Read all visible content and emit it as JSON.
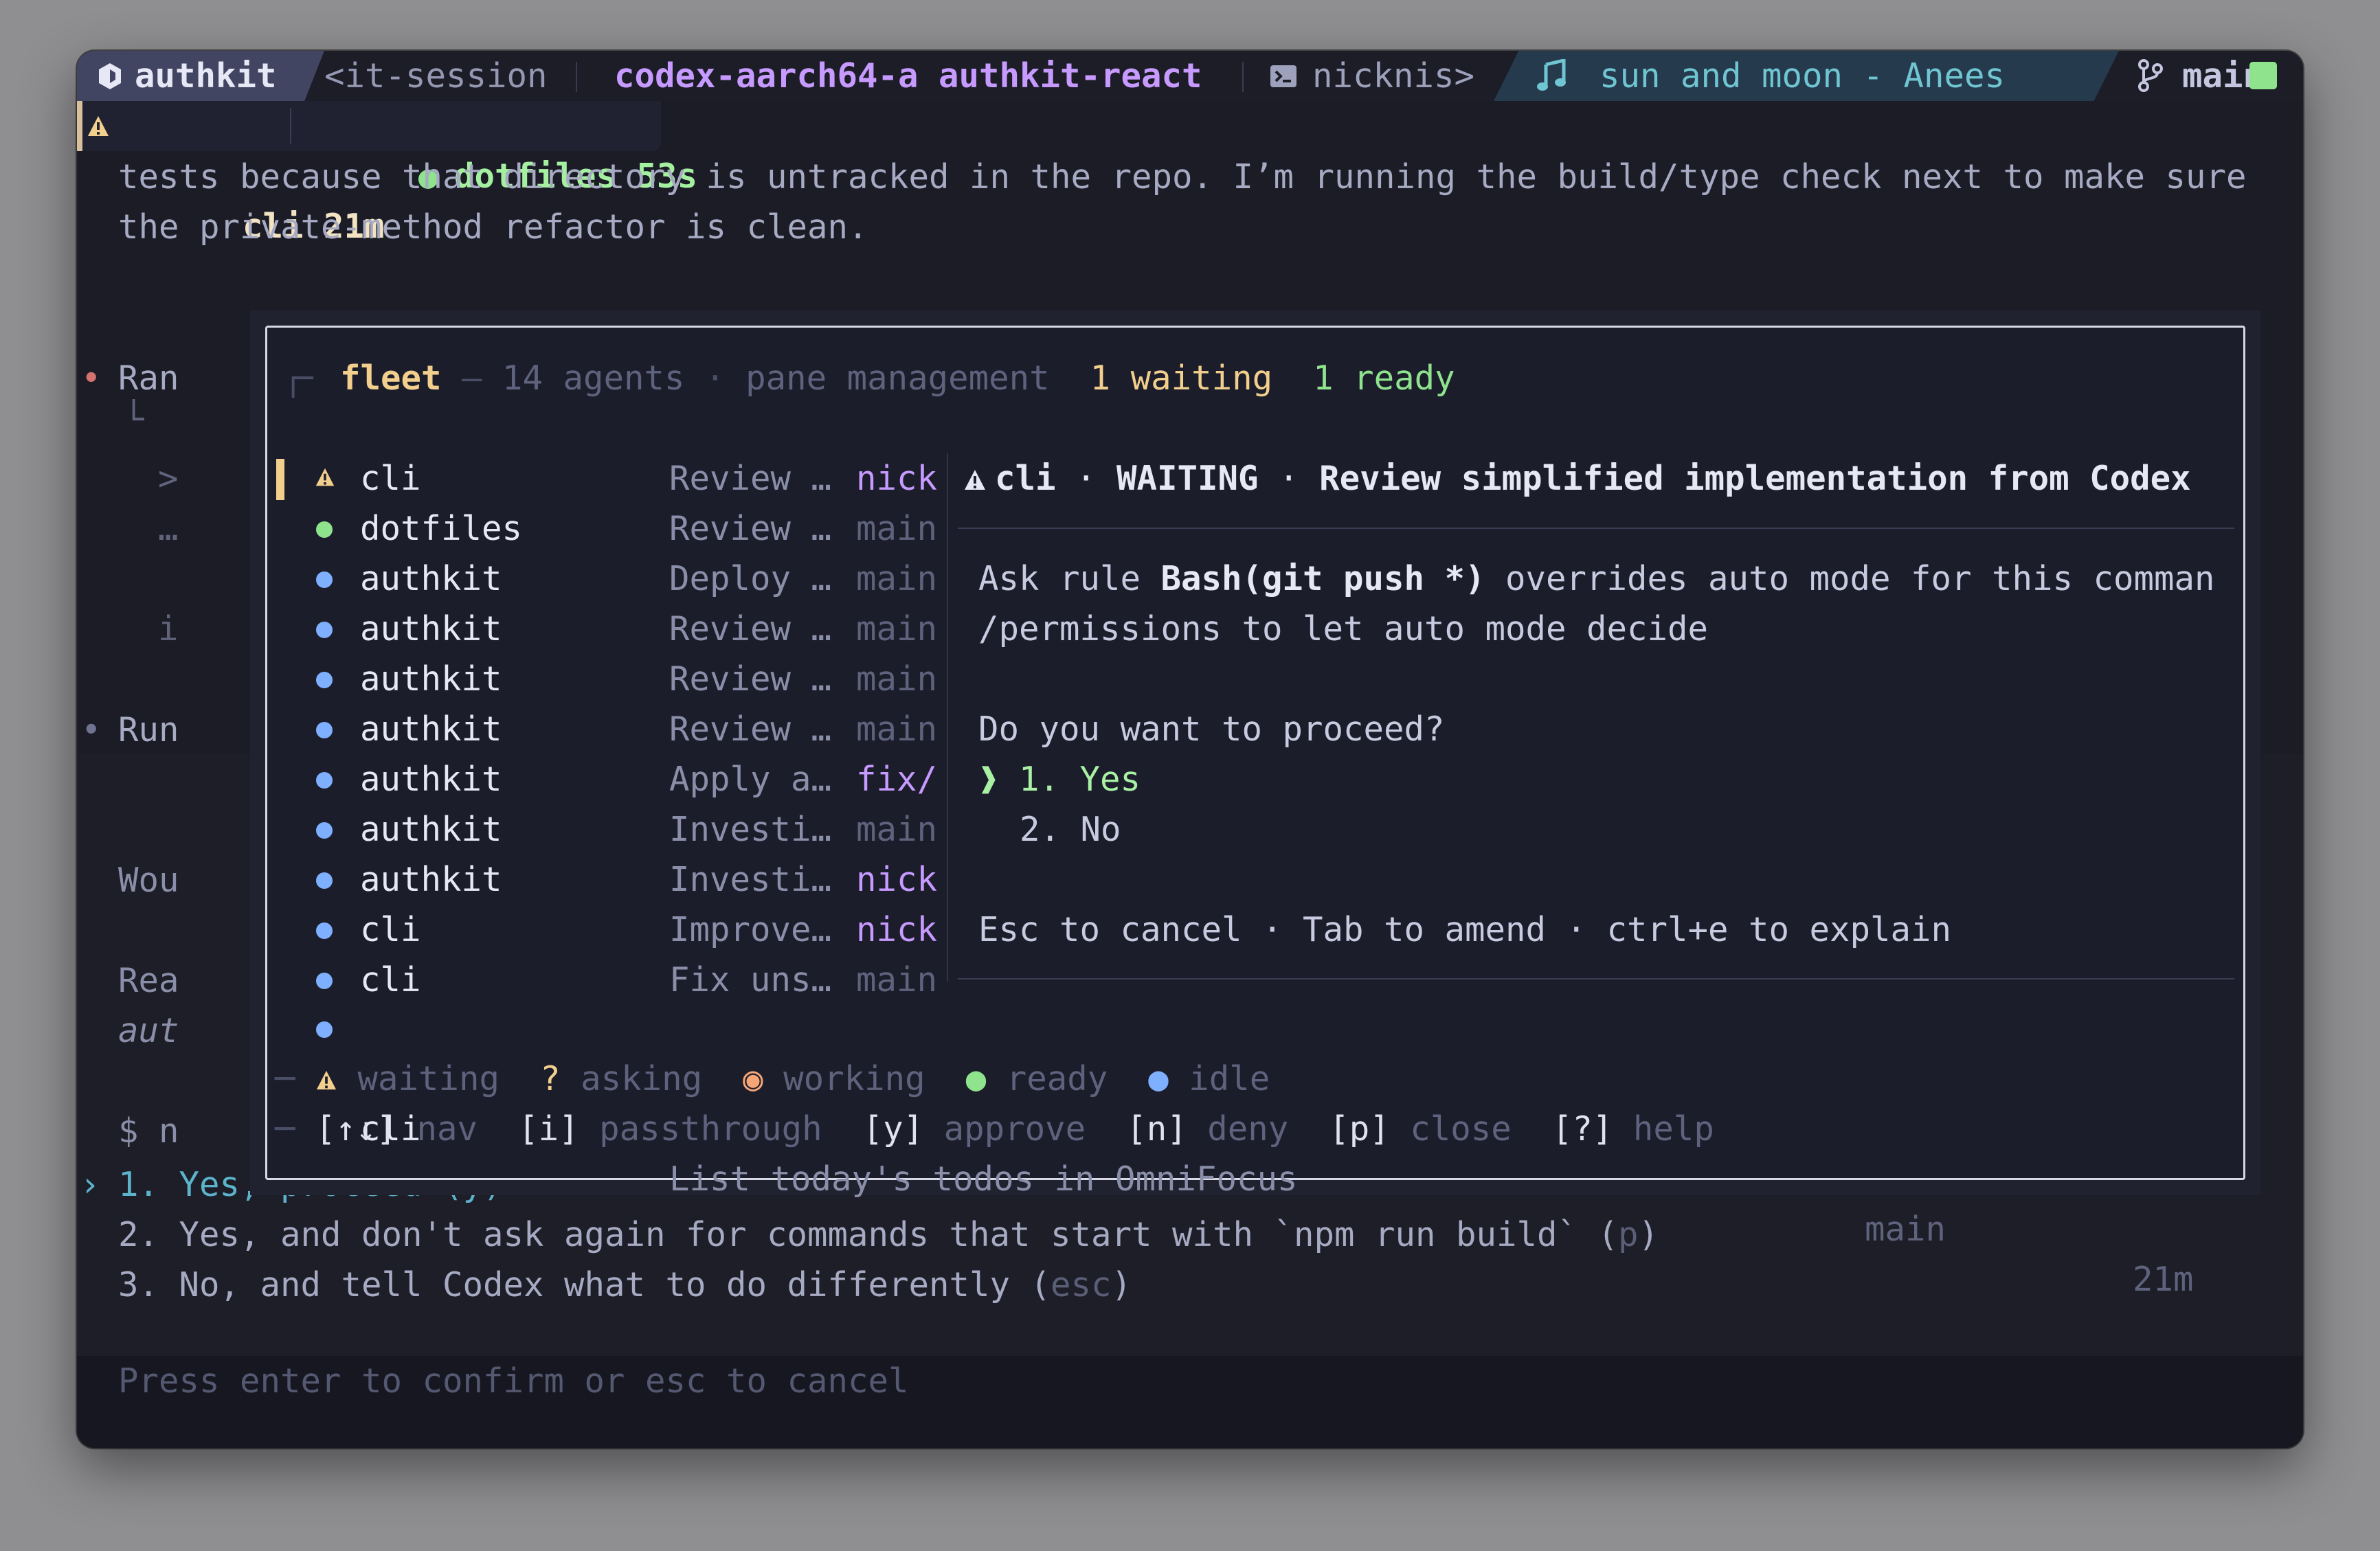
{
  "statusbar": {
    "session": "authkit",
    "session_suffix": "<it-session",
    "host": "codex-aarch64-a authkit-react",
    "shell": "nicknis>",
    "music": "sun and moon - Anees",
    "branch": "main"
  },
  "tabs": [
    {
      "label": "cli 21m"
    },
    {
      "label": "dotfiles 53s"
    }
  ],
  "background": {
    "line1": "tests because that directory is untracked in the repo. I’m running the build/type check next to make sure",
    "line2": "the private-method refactor is clean.",
    "ran": "Ran",
    "run": "Run",
    "wou": "Wou",
    "rea": "Rea",
    "aut": "aut",
    "prompt": "$ n",
    "gt": ">",
    "ellipsis": "…",
    "i": "i",
    "elbow": "└"
  },
  "fleet": {
    "title": "fleet",
    "agents": "14 agents",
    "subtitle": "pane management",
    "waiting": "1 waiting",
    "ready": "1 ready",
    "rows": [
      {
        "name": "cli",
        "desc": "Review …",
        "branch": "nick",
        "status": "waiting"
      },
      {
        "name": "dotfiles",
        "desc": "Review …",
        "branch": "main",
        "status": "ready"
      },
      {
        "name": "authkit",
        "desc": "Deploy …",
        "branch": "main",
        "status": "idle"
      },
      {
        "name": "authkit",
        "desc": "Review …",
        "branch": "main",
        "status": "idle"
      },
      {
        "name": "authkit",
        "desc": "Review …",
        "branch": "main",
        "status": "idle"
      },
      {
        "name": "authkit",
        "desc": "Review …",
        "branch": "main",
        "status": "idle"
      },
      {
        "name": "authkit",
        "desc": "Apply a…",
        "branch": "fix/",
        "status": "idle"
      },
      {
        "name": "authkit",
        "desc": "Investi…",
        "branch": "main",
        "status": "idle"
      },
      {
        "name": "authkit",
        "desc": "Investi…",
        "branch": "nick",
        "status": "idle"
      },
      {
        "name": "cli",
        "desc": "Improve…",
        "branch": "nick",
        "status": "idle"
      },
      {
        "name": "cli",
        "desc": "Fix uns…",
        "branch": "main",
        "status": "idle"
      }
    ],
    "last_row": {
      "name": "cli",
      "desc": "List today's todos in OmniFocus",
      "branch": "main",
      "time": "21m"
    },
    "detail": {
      "header_name": "cli",
      "header_state": "WAITING",
      "header_title": "Review simplified implementation from Codex",
      "line1_pre": "Ask rule ",
      "line1_rule": "Bash(git push *)",
      "line1_post": " overrides auto mode for this comman",
      "line2": "/permissions to let auto mode decide",
      "question": "Do you want to proceed?",
      "opt_yes": "1. Yes",
      "opt_no": "2. No",
      "hint": "Esc to cancel · Tab to amend · ctrl+e to explain"
    },
    "legend": {
      "waiting": "waiting",
      "asking": "asking",
      "working": "working",
      "ready": "ready",
      "idle": "idle"
    },
    "keys": {
      "nav_key": "[↑↓]",
      "nav": "nav",
      "pass_key": "[i]",
      "pass": "passthrough",
      "approve_key": "[y]",
      "approve": "approve",
      "deny_key": "[n]",
      "deny": "deny",
      "close_key": "[p]",
      "close": "close",
      "help_key": "[?]",
      "help": "help"
    }
  },
  "options": {
    "opt1": "1. Yes, proceed (y)",
    "opt2_main": "2. Yes, and don't ask again for commands that start with `npm run build` (",
    "opt2_key": "p",
    "opt2_end": ")",
    "opt3_main": "3. No, and tell Codex what to do differently (",
    "opt3_key": "esc",
    "opt3_end": ")"
  },
  "footer": "Press enter to confirm or esc to cancel",
  "colors": {
    "waiting": "#f2cf8c",
    "ready": "#8fe38d",
    "idle": "#7fb0ff",
    "working": "#f5a576",
    "branch": "#c79aff"
  }
}
